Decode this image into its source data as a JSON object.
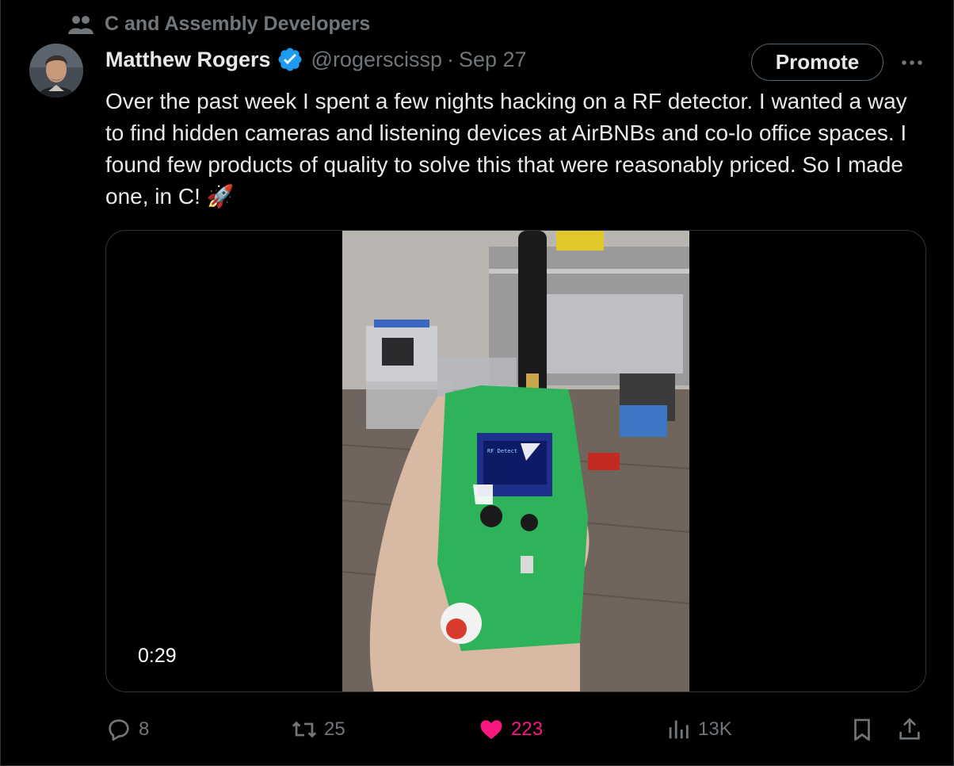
{
  "community": {
    "name": "C and Assembly Developers",
    "icon": "people-icon"
  },
  "tweet": {
    "author_name": "Matthew Rogers",
    "handle": "@rogerscissp",
    "separator": "·",
    "date": "Sep 27",
    "verified": true,
    "text": "Over the past week I spent a few nights hacking on a RF detector. I wanted a way to find hidden cameras and listening devices at AirBNBs and co-lo office spaces. I found few products of quality to solve this that were reasonably priced. So I made one, in C! 🚀"
  },
  "promote_label": "Promote",
  "media": {
    "duration": "0:29"
  },
  "actions": {
    "replies": "8",
    "reposts": "25",
    "likes": "223",
    "views": "13K"
  },
  "colors": {
    "background": "#000000",
    "text": "#e7e9ea",
    "muted": "#71767b",
    "like": "#f91880",
    "verified": "#1d9bf0",
    "device_green": "#2fb35a"
  }
}
